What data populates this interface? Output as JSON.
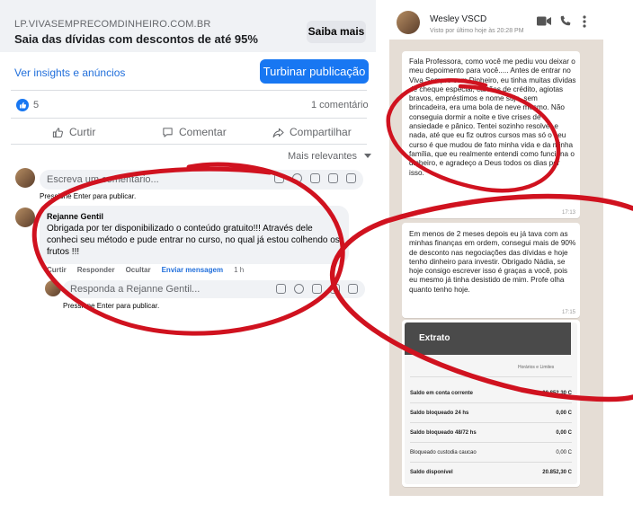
{
  "facebook": {
    "link_domain": "LP.VIVASEMPRECOMDINHEIRO.COM.BR",
    "link_title": "Saia das dívidas com descontos de até 95%",
    "saiba_mais": "Saiba mais",
    "insights_link": "Ver insights e anúncios",
    "boost_button": "Turbinar publicação",
    "likes_count": "5",
    "comments_count": "1 comentário",
    "actions": {
      "like": "Curtir",
      "comment": "Comentar",
      "share": "Compartilhar"
    },
    "sort_label": "Mais relevantes",
    "comment_placeholder": "Escreva um comentário...",
    "comment_hint": "Pressione Enter para publicar.",
    "comment": {
      "author": "Rejanne Gentil",
      "text": "Obrigada por ter disponibilizado o conteúdo gratuito!!! Através dele conheci seu método e pude entrar no curso, no qual já estou colhendo os frutos !!!",
      "action_like": "Curtir",
      "action_reply": "Responder",
      "action_hide": "Ocultar",
      "action_message": "Enviar mensagem",
      "time": "1 h"
    },
    "reply_placeholder": "Responda a Rejanne Gentil...",
    "reply_hint": "Pressione Enter para publicar."
  },
  "whatsapp": {
    "contact_name": "Wesley VSCD",
    "last_seen": "Visto por último hoje às 20:28 PM",
    "messages": [
      {
        "text": "Fala Professora, como você me pediu vou deixar o meu depoimento para você..... Antes de entrar no Viva Sempre com Dinheiro, eu tinha muitas dívidas de cheque especial, cartões de crédito, agiotas bravos, empréstimos e nome sujo, sem brincadeira, era uma bola de neve mesmo. Não conseguia dormir a noite e tive crises de ansiedade e pânico. Tentei sozinho resolver e nada, até que eu fiz outros cursos mas só o seu curso é que mudou de fato minha vida e da minha família, que eu realmente entendi como funciona o dinheiro, e agradeço a Deus todos os dias por isso.",
        "time": "17:13"
      },
      {
        "text": "Em menos de 2 meses depois eu já tava com as minhas finanças em ordem, consegui mais de 90% de desconto nas negociações das dívidas e hoje tenho dinheiro para investir. Obrigado Nádia, se hoje consigo escrever isso é graças a você, pois eu mesmo já tinha desistido de mim. Profe olha quanto tenho hoje.",
        "time": "17:15"
      }
    ],
    "statement": {
      "title": "Extrato",
      "subtitle": "Horários e Limites",
      "rows": [
        {
          "label": "Saldo em conta corrente",
          "value": "20.852,30 C",
          "bold": true
        },
        {
          "label": "Saldo bloqueado 24 hs",
          "value": "0,00 C",
          "bold": true
        },
        {
          "label": "Saldo bloqueado 48/72 hs",
          "value": "0,00 C",
          "bold": true
        },
        {
          "label": "Bloqueado custodia caucao",
          "value": "0,00 C",
          "bold": false
        },
        {
          "label": "Saldo disponível",
          "value": "20.852,30 C",
          "bold": true
        }
      ]
    }
  },
  "colors": {
    "facebook_blue": "#1877f2",
    "link_blue": "#216fdb",
    "highlight_red": "#d0121f"
  },
  "icons": [
    "like-reaction-icon",
    "thumbs-up-icon",
    "comment-icon",
    "share-icon",
    "caret-down-icon",
    "video-call-icon",
    "phone-icon",
    "more-vert-icon"
  ]
}
